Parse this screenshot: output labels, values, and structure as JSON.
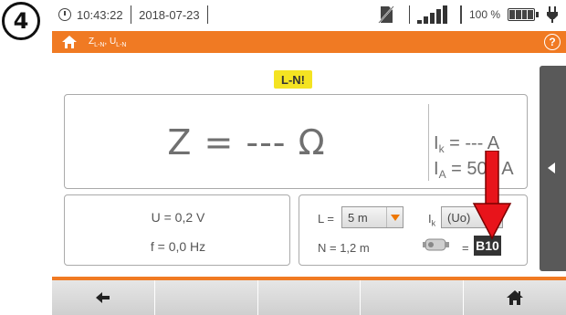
{
  "step_badge": "4",
  "status": {
    "time": "10:43:22",
    "date": "2018-07-23",
    "battery_percent": "100 %",
    "signal_bars": 5
  },
  "titlebar": {
    "title_main": "Z",
    "title_sub1": "L-N",
    "title_mid": ", U",
    "title_sub2": "L-N",
    "help": "?"
  },
  "warning_badge": "L-N!",
  "measurement": {
    "z_value": "Z = --- Ω",
    "ik_symbol": "I",
    "ik_sub": "k",
    "ik_value": " = --- A",
    "ia_symbol": "I",
    "ia_sub": "A",
    "ia_value": " = 500 A"
  },
  "secondary": {
    "voltage": "U = 0,2 V",
    "frequency": "f = 0,0 Hz"
  },
  "settings": {
    "l_label": "L =",
    "l_value": "5 m",
    "n_value": "N = 1,2 m",
    "ik_label": "I",
    "ik_label_sub": "k",
    "ik_option": "(Uo)",
    "fuse_equals": "=",
    "fuse_type": "B10"
  },
  "colors": {
    "accent": "#f07a23",
    "warning": "#f4e322",
    "arrow": "#e8141b"
  },
  "icons": {
    "home": "home-icon",
    "back": "back-arrow-icon",
    "help": "help-icon",
    "menu_expand": "triangle-left-icon"
  }
}
